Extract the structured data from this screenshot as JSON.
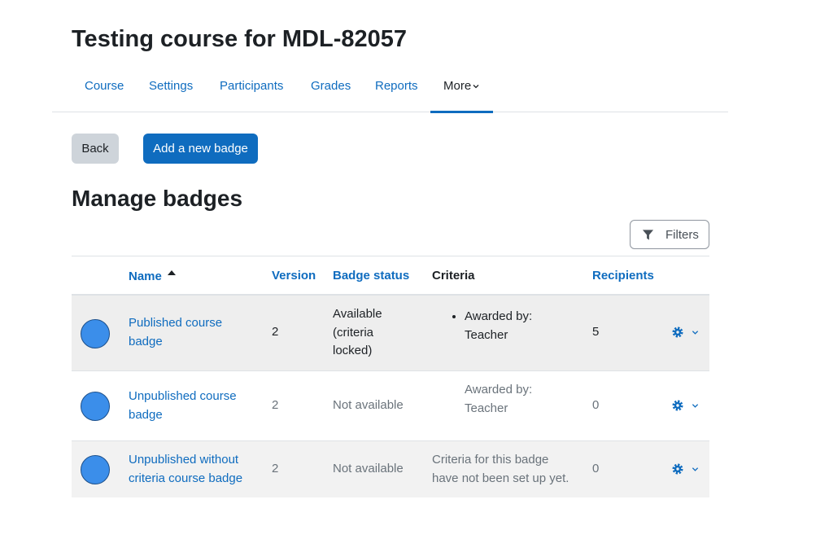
{
  "course": {
    "title": "Testing course for MDL-82057"
  },
  "nav": {
    "items": [
      {
        "label": "Course"
      },
      {
        "label": "Settings"
      },
      {
        "label": "Participants"
      },
      {
        "label": "Grades"
      },
      {
        "label": "Reports"
      },
      {
        "label": "More",
        "icon": "chevron-down-icon",
        "active": true
      }
    ]
  },
  "actions": {
    "back_label": "Back",
    "add_label": "Add a new badge"
  },
  "section": {
    "title": "Manage badges"
  },
  "filters": {
    "label": "Filters",
    "icon": "filter-icon"
  },
  "table": {
    "headers": {
      "name": "Name",
      "version": "Version",
      "status": "Badge status",
      "criteria": "Criteria",
      "recipients": "Recipients"
    },
    "sort": {
      "column": "name",
      "direction": "ascending",
      "icon": "sort-up-icon"
    },
    "rows": [
      {
        "name": "Published course badge",
        "version": "2",
        "status": "Available (criteria locked)",
        "criteria": "Awarded by: Teacher",
        "recipients": "5"
      },
      {
        "name": "Unpublished course badge",
        "version": "2",
        "status": "Not available",
        "criteria": "Awarded by: Teacher",
        "recipients": "0"
      },
      {
        "name": "Unpublished without criteria course badge",
        "version": "2",
        "status": "Not available",
        "criteria": "Criteria for this badge have not been set up yet.",
        "recipients": "0"
      }
    ]
  },
  "colors": {
    "link": "#0f6cbf",
    "primary_button": "#0f6cbf",
    "secondary_button": "#ced4da",
    "badge_fill": "#3b8eea",
    "muted_text": "#6a737b"
  }
}
